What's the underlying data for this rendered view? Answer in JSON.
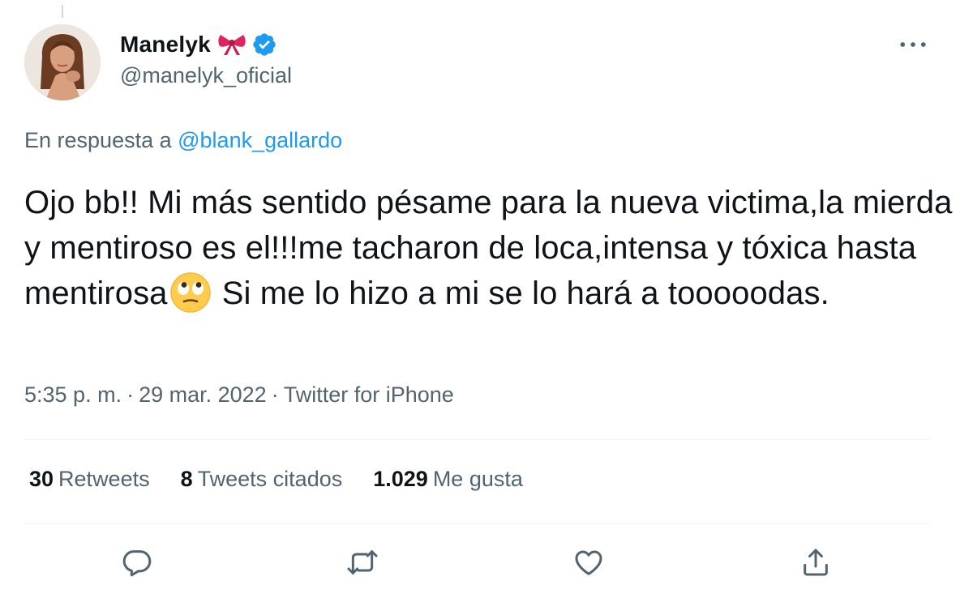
{
  "tweet": {
    "author": {
      "display_name": "Manelyk",
      "handle": "@manelyk_oficial",
      "avatar_icon": "profile-photo",
      "badge_icon": "ribbon-bow-emoji",
      "verified_icon": "verified-badge",
      "verified_color": "#1d9bf0"
    },
    "more_icon": "more-dots",
    "reply_context": {
      "prefix": "En respuesta a ",
      "mention": "@blank_gallardo"
    },
    "text": {
      "part1": "Ojo bb!! Mi más sentido pésame para la nueva victima,la mierda y mentiroso es el!!!me tacharon de loca,intensa y tóxica hasta mentirosa",
      "emoji": "face-with-rolling-eyes",
      "part2": " Si me lo hizo a mi se lo hará a tooooodas."
    },
    "meta": {
      "time": "5:35 p. m.",
      "separator": "·",
      "date": "29 mar. 2022",
      "source": "Twitter for iPhone"
    },
    "stats": {
      "retweets_count": "30",
      "retweets_label": "Retweets",
      "quotes_count": "8",
      "quotes_label": "Tweets citados",
      "likes_count": "1.029",
      "likes_label": "Me gusta"
    },
    "actions": [
      "reply-icon",
      "retweet-icon",
      "like-icon",
      "share-icon"
    ],
    "colors": {
      "text_primary": "#0f1419",
      "text_secondary": "#536471",
      "accent": "#1d9bf0",
      "divider": "#eff3f4"
    }
  }
}
